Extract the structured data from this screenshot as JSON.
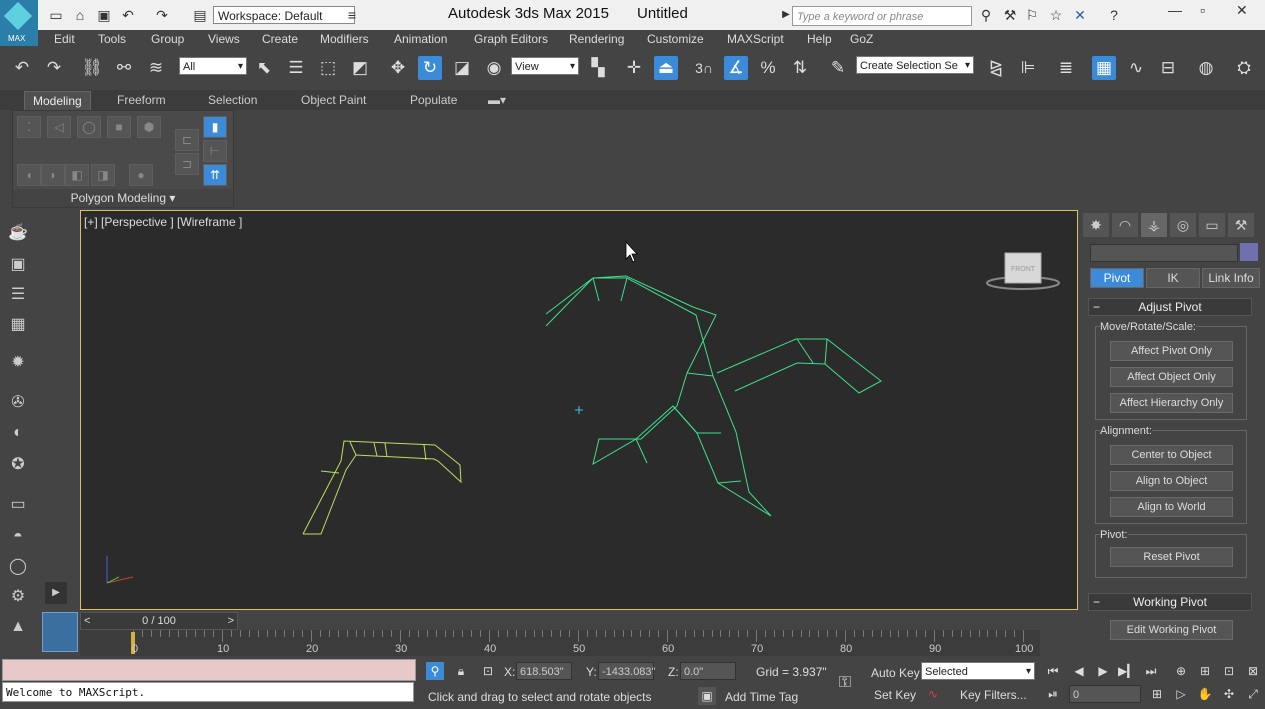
{
  "titlebar": {
    "logo_label": "MAX",
    "workspace": "Workspace: Default",
    "app_title": "Autodesk 3ds Max  2015",
    "doc_title": "Untitled",
    "search_placeholder": "Type a keyword or phrase"
  },
  "menu": [
    "Edit",
    "Tools",
    "Group",
    "Views",
    "Create",
    "Modifiers",
    "Animation",
    "Graph Editors",
    "Rendering",
    "Customize",
    "MAXScript",
    "Help",
    "GoZ"
  ],
  "toolbar": {
    "selection_filter": "All",
    "ref_coord": "View",
    "snap_label": "3",
    "named_selection_placeholder": "Create Selection Se"
  },
  "ribbon": {
    "tabs": [
      "Modeling",
      "Freeform",
      "Selection",
      "Object Paint",
      "Populate"
    ],
    "panel_label": "Polygon Modeling"
  },
  "viewport": {
    "label": "[+] [Perspective ] [Wireframe ]",
    "viewcube_label": "FRONT"
  },
  "command_panel": {
    "subtabs": [
      "Pivot",
      "IK",
      "Link Info"
    ],
    "adjust_pivot": {
      "title": "Adjust Pivot",
      "move_group": "Move/Rotate/Scale:",
      "buttons1": [
        "Affect Pivot Only",
        "Affect Object Only",
        "Affect Hierarchy Only"
      ],
      "align_group": "Alignment:",
      "buttons2": [
        "Center to Object",
        "Align to Object",
        "Align to World"
      ],
      "pivot_group": "Pivot:",
      "reset": "Reset Pivot"
    },
    "working_pivot": {
      "title": "Working Pivot",
      "edit": "Edit Working Pivot"
    }
  },
  "timeline": {
    "slider": "0 / 100",
    "prev": "<",
    "next": ">",
    "ticks": [
      "0",
      "10",
      "20",
      "30",
      "40",
      "50",
      "60",
      "70",
      "80",
      "90",
      "100"
    ]
  },
  "status": {
    "maxscript_output": "Welcome to MAXScript.",
    "x_label": "X:",
    "x_value": "618.503\"",
    "y_label": "Y:",
    "y_value": "-1433.083\"",
    "z_label": "Z:",
    "z_value": "0.0\"",
    "grid": "Grid = 3.937\"",
    "prompt": "Click and drag to select and rotate objects",
    "add_time_tag": "Add Time Tag",
    "auto_key": "Auto Key",
    "set_key": "Set Key",
    "key_mode": "Selected",
    "key_filters": "Key Filters...",
    "frame": "0"
  }
}
